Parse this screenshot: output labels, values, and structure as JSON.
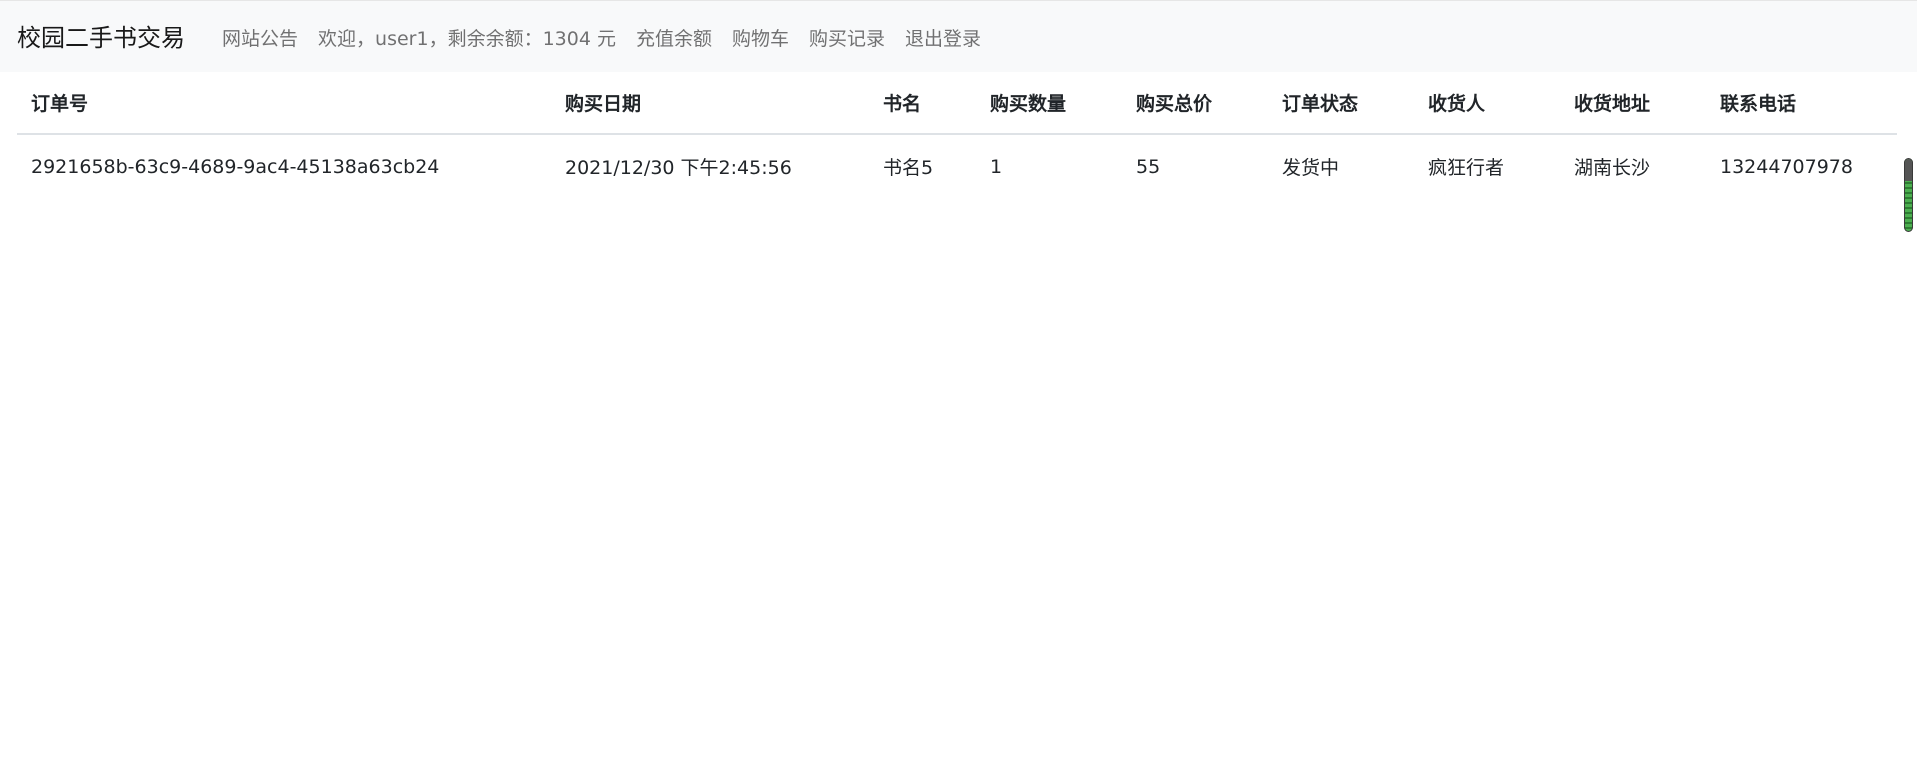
{
  "navbar": {
    "brand": "校园二手书交易",
    "announcement": "网站公告",
    "welcome_prefix": "欢迎，",
    "username": "user1",
    "balance_label": "，剩余余额：",
    "balance": "1304",
    "balance_unit": "元",
    "recharge": "充值余额",
    "cart": "购物车",
    "purchase_history": "购买记录",
    "logout": "退出登录"
  },
  "table": {
    "headers": [
      "订单号",
      "购买日期",
      "书名",
      "购买数量",
      "购买总价",
      "订单状态",
      "收货人",
      "收货地址",
      "联系电话"
    ],
    "rows": [
      [
        "2921658b-63c9-4689-9ac4-45138a63cb24",
        "2021/12/30 下午2:45:56",
        "书名5",
        "1",
        "55",
        "发货中",
        "疯狂行者",
        "湖南长沙",
        "13244707978"
      ]
    ]
  },
  "colors": {
    "navbar_bg": "#f8f9fa",
    "nav_link": "#8c8c8c",
    "scroll_indicator": "#4caf50"
  }
}
